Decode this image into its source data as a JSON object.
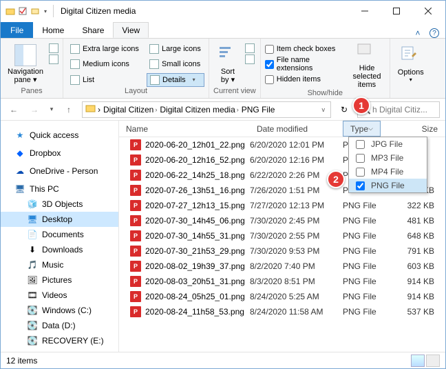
{
  "title": "Digital Citizen media",
  "tabs": {
    "file": "File",
    "home": "Home",
    "share": "Share",
    "view": "View"
  },
  "ribbon": {
    "panes": {
      "navpane": "Navigation\npane",
      "label": "Panes"
    },
    "layout": {
      "xl": "Extra large icons",
      "l": "Large icons",
      "m": "Medium icons",
      "s": "Small icons",
      "list": "List",
      "details": "Details",
      "label": "Layout"
    },
    "sort": {
      "btn": "Sort\nby",
      "label": "Current view"
    },
    "show": {
      "cb1": "Item check boxes",
      "cb2": "File name extensions",
      "cb3": "Hidden items",
      "hide": "Hide selected\nitems",
      "label": "Show/hide"
    },
    "options": "Options"
  },
  "breadcrumbs": [
    "Digital Citizen",
    "Digital Citizen media",
    "PNG File"
  ],
  "search_hint": "h Digital Citiz...",
  "columns": {
    "name": "Name",
    "date": "Date modified",
    "type": "Type",
    "size": "Size"
  },
  "filter": {
    "jpg": "JPG File",
    "mp3": "MP3 File",
    "mp4": "MP4 File",
    "png": "PNG File"
  },
  "annotations": {
    "a1": "1",
    "a2": "2"
  },
  "nav": {
    "quick": "Quick access",
    "dropbox": "Dropbox",
    "onedrive": "OneDrive - Person",
    "thispc": "This PC",
    "obj3d": "3D Objects",
    "desktop": "Desktop",
    "docs": "Documents",
    "dl": "Downloads",
    "music": "Music",
    "pics": "Pictures",
    "videos": "Videos",
    "c": "Windows (C:)",
    "d": "Data (D:)",
    "e": "RECOVERY (E:)"
  },
  "files": [
    {
      "name": "2020-06-20_12h01_22.png",
      "date": "6/20/2020 12:01 PM",
      "type": "PN",
      "size": ""
    },
    {
      "name": "2020-06-20_12h16_52.png",
      "date": "6/20/2020 12:16 PM",
      "type": "PN",
      "size": ""
    },
    {
      "name": "2020-06-22_14h25_18.png",
      "date": "6/22/2020 2:26 PM",
      "type": "PN",
      "size": ""
    },
    {
      "name": "2020-07-26_13h51_16.png",
      "date": "7/26/2020 1:51 PM",
      "type": "PN",
      "size": "284 KB"
    },
    {
      "name": "2020-07-27_12h13_15.png",
      "date": "7/27/2020 12:13 PM",
      "type": "PNG File",
      "size": "322 KB"
    },
    {
      "name": "2020-07-30_14h45_06.png",
      "date": "7/30/2020 2:45 PM",
      "type": "PNG File",
      "size": "481 KB"
    },
    {
      "name": "2020-07-30_14h55_31.png",
      "date": "7/30/2020 2:55 PM",
      "type": "PNG File",
      "size": "648 KB"
    },
    {
      "name": "2020-07-30_21h53_29.png",
      "date": "7/30/2020 9:53 PM",
      "type": "PNG File",
      "size": "791 KB"
    },
    {
      "name": "2020-08-02_19h39_37.png",
      "date": "8/2/2020 7:40 PM",
      "type": "PNG File",
      "size": "603 KB"
    },
    {
      "name": "2020-08-03_20h51_31.png",
      "date": "8/3/2020 8:51 PM",
      "type": "PNG File",
      "size": "914 KB"
    },
    {
      "name": "2020-08-24_05h25_01.png",
      "date": "8/24/2020 5:25 AM",
      "type": "PNG File",
      "size": "914 KB"
    },
    {
      "name": "2020-08-24_11h58_53.png",
      "date": "8/24/2020 11:58 AM",
      "type": "PNG File",
      "size": "537 KB"
    }
  ],
  "status": "12 items"
}
